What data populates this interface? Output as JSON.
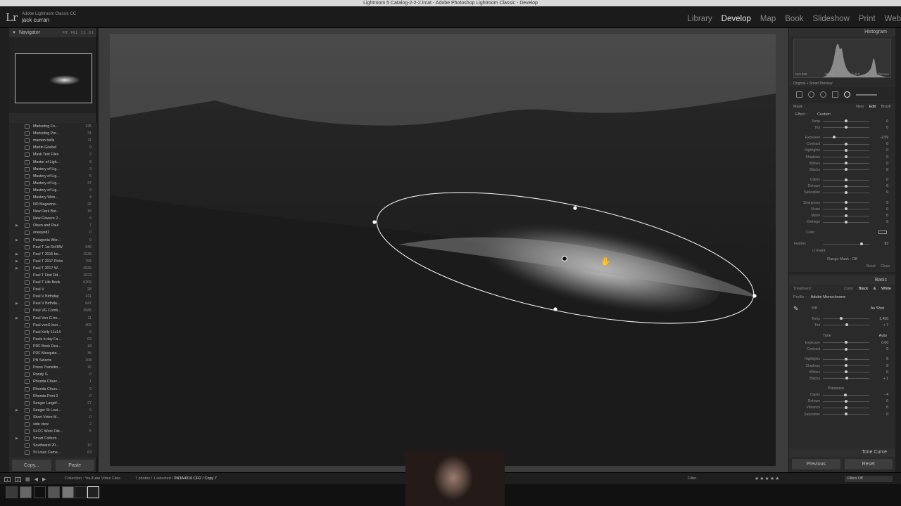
{
  "window": {
    "title": "Lightroom 5 Catalog-2-2-2.lrcat - Adobe Photoshop Lightroom Classic - Develop"
  },
  "identity": {
    "logo": "Lr",
    "app_name": "Adobe Lightroom Classic CC",
    "user": "jack curran"
  },
  "modules": [
    {
      "label": "Library",
      "active": false
    },
    {
      "label": "Develop",
      "active": true
    },
    {
      "label": "Map",
      "active": false
    },
    {
      "label": "Book",
      "active": false
    },
    {
      "label": "Slideshow",
      "active": false
    },
    {
      "label": "Print",
      "active": false
    },
    {
      "label": "Web",
      "active": false
    }
  ],
  "navigator": {
    "title": "Navigator",
    "zoom_options": "FIT FILL 1:1 3:1"
  },
  "collections": [
    {
      "name": "Marketing Fo...",
      "count": "125",
      "expandable": false
    },
    {
      "name": "Marketing Por...",
      "count": "31",
      "expandable": false
    },
    {
      "name": "maroon bells",
      "count": "11",
      "expandable": false
    },
    {
      "name": "Martin Goebel",
      "count": "0",
      "expandable": false
    },
    {
      "name": "Mask Test Files",
      "count": "2",
      "expandable": false
    },
    {
      "name": "Master of Ligh...",
      "count": "8",
      "expandable": false
    },
    {
      "name": "Mastery of Lig...",
      "count": "3",
      "expandable": false
    },
    {
      "name": "Mastery of Lig...",
      "count": "5",
      "expandable": false
    },
    {
      "name": "Mastery of Lig...",
      "count": "37",
      "expandable": false
    },
    {
      "name": "Mastery of Lig...",
      "count": "9",
      "expandable": false
    },
    {
      "name": "Mastery Web...",
      "count": "4",
      "expandable": false
    },
    {
      "name": "ND Magazine...",
      "count": "26",
      "expandable": false
    },
    {
      "name": "New Dark Bot...",
      "count": "15",
      "expandable": false
    },
    {
      "name": "New Flowers 2...",
      "count": "6",
      "expandable": false
    },
    {
      "name": "Olsen and Paul",
      "count": "7",
      "expandable": true
    },
    {
      "name": "oneeyed2",
      "count": "0",
      "expandable": false
    },
    {
      "name": "Patagonia Wor...",
      "count": "0",
      "expandable": true
    },
    {
      "name": "Paul T 1st Rd BW",
      "count": "340",
      "expandable": false
    },
    {
      "name": "Paul T 2016 bo...",
      "count": "1939",
      "expandable": true
    },
    {
      "name": "Paul T 2017 Picks",
      "count": "794",
      "expandable": true
    },
    {
      "name": "Paul T 2017 W...",
      "count": "4939",
      "expandable": true
    },
    {
      "name": "Paul T First Rd...",
      "count": "1623",
      "expandable": false
    },
    {
      "name": "Paul T Life Book",
      "count": "6209",
      "expandable": false
    },
    {
      "name": "Paul V",
      "count": "28",
      "expandable": false
    },
    {
      "name": "Paul V Birthday",
      "count": "411",
      "expandable": false
    },
    {
      "name": "Paul V Birthda...",
      "count": "847",
      "expandable": true
    },
    {
      "name": "Paul VG Comb...",
      "count": "3586",
      "expandable": false
    },
    {
      "name": "Paul Von G bo...",
      "count": "11",
      "expandable": true
    },
    {
      "name": "Paul vonG boo...",
      "count": "402",
      "expandable": false
    },
    {
      "name": "Paul Kelly 11x14",
      "count": "9",
      "expandable": false
    },
    {
      "name": "Pauls b day Fa...",
      "count": "63",
      "expandable": false
    },
    {
      "name": "PDF Book Dea...",
      "count": "18",
      "expandable": false
    },
    {
      "name": "PDF Mesquite...",
      "count": "35",
      "expandable": false
    },
    {
      "name": "PN Selects",
      "count": "108",
      "expandable": false
    },
    {
      "name": "Preso Transitio...",
      "count": "16",
      "expandable": false
    },
    {
      "name": "Randy G",
      "count": "0",
      "expandable": false
    },
    {
      "name": "Rhonda Churc...",
      "count": "1",
      "expandable": false
    },
    {
      "name": "Rhonda Churc...",
      "count": "0",
      "expandable": false
    },
    {
      "name": "Rhonda Print 2",
      "count": "0",
      "expandable": false
    },
    {
      "name": "Seeger Largef...",
      "count": "27",
      "expandable": false
    },
    {
      "name": "Seeger St Loui...",
      "count": "9",
      "expandable": true
    },
    {
      "name": "Short Video M...",
      "count": "0",
      "expandable": false
    },
    {
      "name": "side view",
      "count": "2",
      "expandable": false
    },
    {
      "name": "SLCC Work File...",
      "count": "5",
      "expandable": false
    },
    {
      "name": "Smart Collecti...",
      "count": "",
      "expandable": true
    },
    {
      "name": "Southwest 20...",
      "count": "10",
      "expandable": false
    },
    {
      "name": "St Louis Came...",
      "count": "63",
      "expandable": false
    }
  ],
  "left_buttons": {
    "copy": "Copy...",
    "paste": "Paste"
  },
  "histogram": {
    "title": "Histogram",
    "iso": "ISO 500",
    "focal": "75 mm",
    "aperture": "f / 8.0",
    "shutter": "1/10 sec",
    "preview": "Original + Smart Preview"
  },
  "mask": {
    "label": "Mask :",
    "new": "New",
    "edit": "Edit",
    "brush": "Brush",
    "effect_label": "Effect :",
    "effect_value": "Custom",
    "sliders": [
      {
        "label": "Temp",
        "value": "0",
        "pos": 0.5
      },
      {
        "label": "Tint",
        "value": "0",
        "pos": 0.5
      },
      {
        "gap": true
      },
      {
        "label": "Exposure",
        "value": "-2.59",
        "pos": 0.24
      },
      {
        "label": "Contrast",
        "value": "0",
        "pos": 0.5
      },
      {
        "label": "Highlights",
        "value": "0",
        "pos": 0.5
      },
      {
        "label": "Shadows",
        "value": "0",
        "pos": 0.5
      },
      {
        "label": "Whites",
        "value": "0",
        "pos": 0.5
      },
      {
        "label": "Blacks",
        "value": "0",
        "pos": 0.5
      },
      {
        "gap": true
      },
      {
        "label": "Clarity",
        "value": "0",
        "pos": 0.5
      },
      {
        "label": "Dehaze",
        "value": "0",
        "pos": 0.5
      },
      {
        "label": "Saturation",
        "value": "0",
        "pos": 0.5
      },
      {
        "gap": true
      },
      {
        "label": "Sharpness",
        "value": "0",
        "pos": 0.5
      },
      {
        "label": "Noise",
        "value": "0",
        "pos": 0.5
      },
      {
        "label": "Moiré",
        "value": "0",
        "pos": 0.5
      },
      {
        "label": "Defringe",
        "value": "0",
        "pos": 0.5
      }
    ],
    "color_label": "Color",
    "feather_label": "Feather",
    "feather_value": "83",
    "feather_pos": 0.83,
    "invert_label": "Invert",
    "range_mask": "Range Mask : Off",
    "reset": "Reset",
    "close": "Close"
  },
  "basic": {
    "title": "Basic",
    "treatment_label": "Treatment :",
    "color": "Color",
    "bw": "Black & White",
    "profile_label": "Profile :",
    "profile_value": "Adobe Monochrome",
    "wb_label": "WB :",
    "wb_value": "As Shot",
    "wb_sliders": [
      {
        "label": "Temp",
        "value": "5,450",
        "pos": 0.4
      },
      {
        "label": "Tint",
        "value": "+ 7",
        "pos": 0.52
      }
    ],
    "tone_label": "Tone",
    "auto": "Auto",
    "tone_sliders": [
      {
        "label": "Exposure",
        "value": "0.00",
        "pos": 0.5
      },
      {
        "label": "Contrast",
        "value": "0",
        "pos": 0.5
      },
      {
        "gap": true
      },
      {
        "label": "Highlights",
        "value": "0",
        "pos": 0.5
      },
      {
        "label": "Shadows",
        "value": "0",
        "pos": 0.5
      },
      {
        "label": "Whites",
        "value": "0",
        "pos": 0.5
      },
      {
        "label": "Blacks",
        "value": "+ 1",
        "pos": 0.51
      }
    ],
    "presence_label": "Presence",
    "presence_sliders": [
      {
        "label": "Clarity",
        "value": "- 4",
        "pos": 0.48
      },
      {
        "label": "Dehaze",
        "value": "0",
        "pos": 0.5
      },
      {
        "label": "Vibrance",
        "value": "0",
        "pos": 0.5
      },
      {
        "label": "Saturation",
        "value": "0",
        "pos": 0.5
      }
    ]
  },
  "tone_curve": {
    "title": "Tone Curve"
  },
  "right_buttons": {
    "previous": "Previous",
    "reset": "Reset"
  },
  "filmbar": {
    "screen1": "1",
    "screen2": "2",
    "source": "Collection : YouTube Video Files",
    "selection_prefix": "7 photos / 1 selected /",
    "selection_file": "0N3A4016.CR2 / Copy 7",
    "filter_label": "Filter :",
    "filters_off": "Filters Off"
  },
  "colors": {
    "accent": "#e8e8e8",
    "panel": "#2a2a2a",
    "background": "#1a1a1a"
  }
}
